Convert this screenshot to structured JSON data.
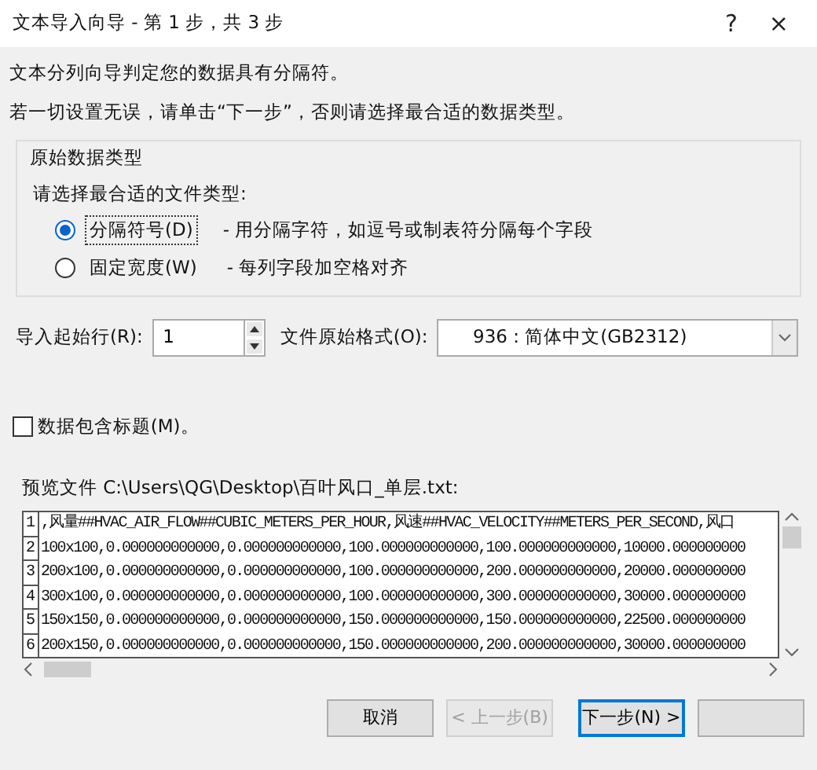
{
  "window": {
    "title": "文本导入向导 - 第 1 步，共 3 步",
    "help": "?",
    "close": "×"
  },
  "intro": [
    "文本分列向导判定您的数据具有分隔符。",
    "若一切设置无误，请单击“下一步”，否则请选择最合适的数据类型。"
  ],
  "data_type_group": {
    "legend": "原始数据类型",
    "prompt": "请选择最合适的文件类型:",
    "options": [
      {
        "label": "分隔符号(D)",
        "description": "- 用分隔字符，如逗号或制表符分隔每个字段",
        "selected": true,
        "focused": true
      },
      {
        "label": "固定宽度(W)",
        "description": "- 每列字段加空格对齐",
        "selected": false,
        "focused": false
      }
    ]
  },
  "start_row": {
    "label": "导入起始行(R):",
    "value": "1"
  },
  "file_origin": {
    "label": "文件原始格式(O):",
    "value": "936 : 简体中文(GB2312)"
  },
  "has_headers": {
    "label": "数据包含标题(M)。",
    "checked": false
  },
  "preview": {
    "label": "预览文件 C:\\Users\\QG\\Desktop\\百叶风口_单层.txt:",
    "rows": [
      {
        "number": "1",
        "text": ",风量##HVAC_AIR_FLOW##CUBIC_METERS_PER_HOUR,风速##HVAC_VELOCITY##METERS_PER_SECOND,风口"
      },
      {
        "number": "2",
        "text": "100x100,0.000000000000,0.000000000000,100.000000000000,100.000000000000,10000.000000000"
      },
      {
        "number": "3",
        "text": "200x100,0.000000000000,0.000000000000,100.000000000000,200.000000000000,20000.000000000"
      },
      {
        "number": "4",
        "text": "300x100,0.000000000000,0.000000000000,100.000000000000,300.000000000000,30000.000000000"
      },
      {
        "number": "5",
        "text": "150x150,0.000000000000,0.000000000000,150.000000000000,150.000000000000,22500.000000000"
      },
      {
        "number": "6",
        "text": "200x150,0.000000000000,0.000000000000,150.000000000000,200.000000000000,30000.000000000"
      }
    ]
  },
  "buttons": [
    {
      "label": "取消",
      "disabled": false,
      "default": false
    },
    {
      "label": "< 上一步(B)",
      "disabled": true,
      "default": false
    },
    {
      "label": "下一步(N) >",
      "disabled": false,
      "default": true
    },
    {
      "disabled": false,
      "default": false
    }
  ]
}
